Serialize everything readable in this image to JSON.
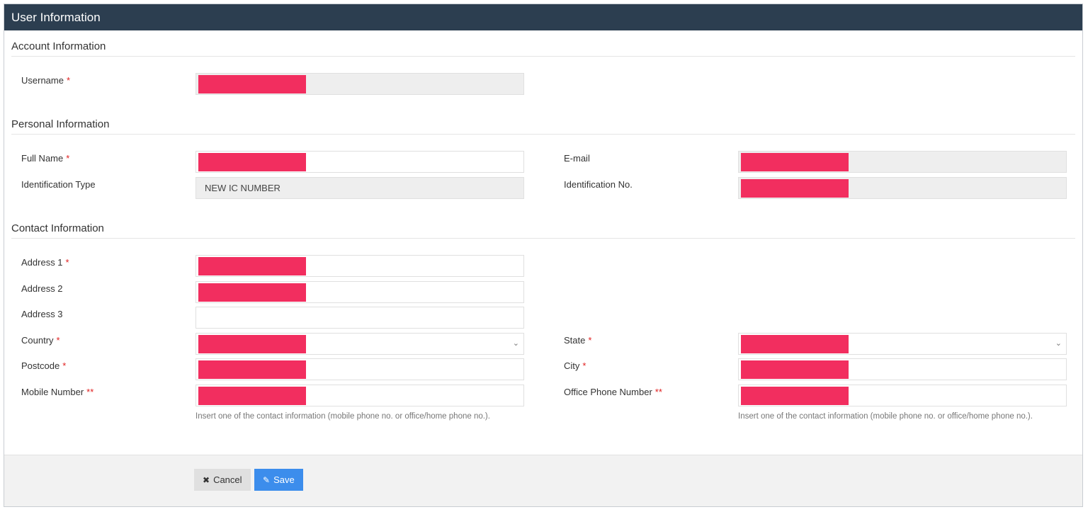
{
  "header": {
    "title": "User Information"
  },
  "sections": {
    "account": "Account Information",
    "personal": "Personal Information",
    "contact": "Contact Information"
  },
  "fields": {
    "username": {
      "label": "Username",
      "required": "*"
    },
    "full_name": {
      "label": "Full Name",
      "required": "*"
    },
    "email": {
      "label": "E-mail"
    },
    "id_type": {
      "label": "Identification Type",
      "value": "NEW IC NUMBER"
    },
    "id_no": {
      "label": "Identification No."
    },
    "address1": {
      "label": "Address 1",
      "required": "*"
    },
    "address2": {
      "label": "Address 2"
    },
    "address3": {
      "label": "Address 3",
      "value": ""
    },
    "country": {
      "label": "Country",
      "required": "*"
    },
    "state": {
      "label": "State",
      "required": "*"
    },
    "postcode": {
      "label": "Postcode",
      "required": "*"
    },
    "city": {
      "label": "City",
      "required": "*"
    },
    "mobile": {
      "label": "Mobile Number",
      "required": "**"
    },
    "office_phone": {
      "label": "Office Phone Number",
      "required": "**"
    }
  },
  "help_text": "Insert one of the contact information (mobile phone no. or office/home phone no.).",
  "buttons": {
    "cancel": "Cancel",
    "save": "Save"
  },
  "icons": {
    "chevron": "chevron-down-icon",
    "cancel": "times-circle-icon",
    "save": "edit-icon"
  },
  "colors": {
    "header_bg": "#2c3e50",
    "required": "#e02020",
    "save_btn": "#3c8dec",
    "redaction": "#f22e5f"
  }
}
